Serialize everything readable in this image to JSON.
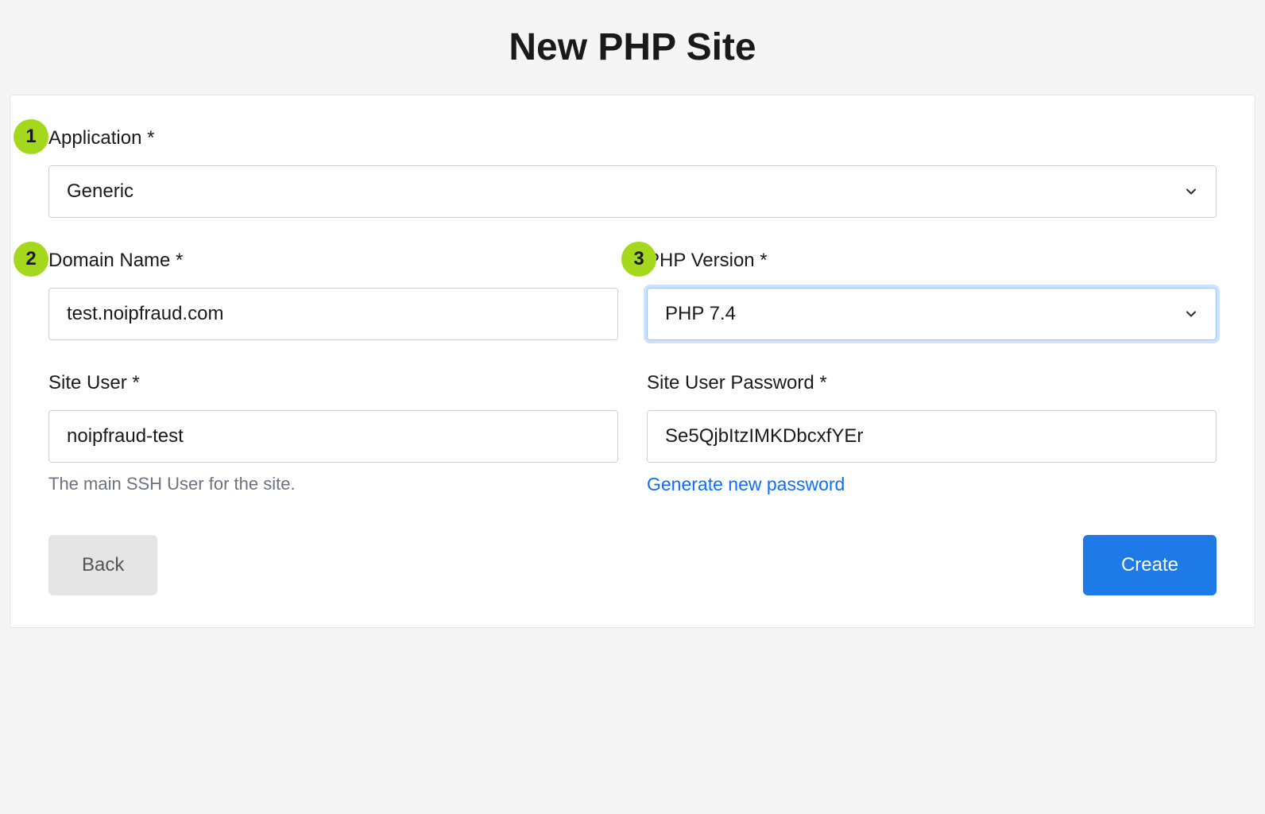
{
  "page": {
    "title": "New PHP Site"
  },
  "form": {
    "application": {
      "label": "Application *",
      "value": "Generic",
      "badge": "1"
    },
    "domain": {
      "label": "Domain Name *",
      "value": "test.noipfraud.com",
      "badge": "2"
    },
    "php": {
      "label": "PHP Version *",
      "value": "PHP 7.4",
      "badge": "3"
    },
    "siteuser": {
      "label": "Site User *",
      "value": "noipfraud-test",
      "help": "The main SSH User for the site."
    },
    "password": {
      "label": "Site User Password *",
      "value": "Se5QjbItzIMKDbcxfYEr",
      "generate": "Generate new password"
    }
  },
  "buttons": {
    "back": "Back",
    "create": "Create"
  }
}
